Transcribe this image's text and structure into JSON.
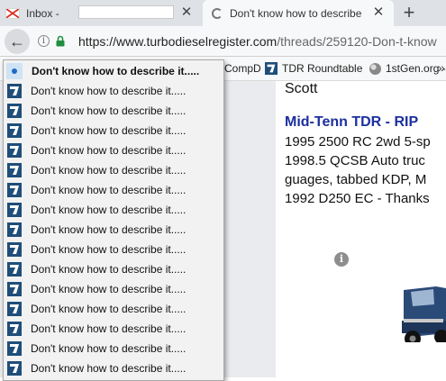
{
  "tabs": [
    {
      "title": "Inbox - ",
      "icon": "gmail-icon",
      "active": false
    },
    {
      "title": "Don't know how to describe",
      "icon": "loading-icon",
      "active": true
    }
  ],
  "tab_close_glyph": "✕",
  "new_tab_glyph": "+",
  "toolbar": {
    "back_glyph": "←",
    "info_glyph": "i",
    "url_host": "https://www.turbodieselregister.com",
    "url_path": "/threads/259120-Don-t-know"
  },
  "bookmarks": [
    {
      "label": "CompD",
      "icon": "none"
    },
    {
      "label": "TDR Roundtable",
      "icon": "tdr-icon"
    },
    {
      "label": "1stGen.org -",
      "icon": "globe-icon"
    }
  ],
  "bookmarks_more": "»",
  "post": {
    "username": "Scott",
    "signature_title": "Mid-Tenn TDR - RIP",
    "signature_lines": [
      "1995 2500 RC 2wd 5-sp",
      "1998.5 QCSB Auto truc",
      "guages, tabbed KDP, M",
      "1992 D250 EC - Thanks"
    ],
    "info_glyph": "i"
  },
  "history_menu": {
    "items": [
      {
        "label": "Don't know how to describe it.....",
        "current": true
      },
      {
        "label": "Don't know how to describe it.....",
        "current": false
      },
      {
        "label": "Don't know how to describe it.....",
        "current": false
      },
      {
        "label": "Don't know how to describe it.....",
        "current": false
      },
      {
        "label": "Don't know how to describe it.....",
        "current": false
      },
      {
        "label": "Don't know how to describe it.....",
        "current": false
      },
      {
        "label": "Don't know how to describe it.....",
        "current": false
      },
      {
        "label": "Don't know how to describe it.....",
        "current": false
      },
      {
        "label": "Don't know how to describe it.....",
        "current": false
      },
      {
        "label": "Don't know how to describe it.....",
        "current": false
      },
      {
        "label": "Don't know how to describe it.....",
        "current": false
      },
      {
        "label": "Don't know how to describe it.....",
        "current": false
      },
      {
        "label": "Don't know how to describe it.....",
        "current": false
      },
      {
        "label": "Don't know how to describe it.....",
        "current": false
      },
      {
        "label": "Don't know how to describe it.....",
        "current": false
      },
      {
        "label": "Don't know how to describe it.....",
        "current": false
      }
    ]
  },
  "colors": {
    "accent_blue": "#1c2f9e",
    "favicon_blue": "#1f4e7a",
    "lock_green": "#1e8e3e",
    "gmail_red": "#d93025"
  }
}
